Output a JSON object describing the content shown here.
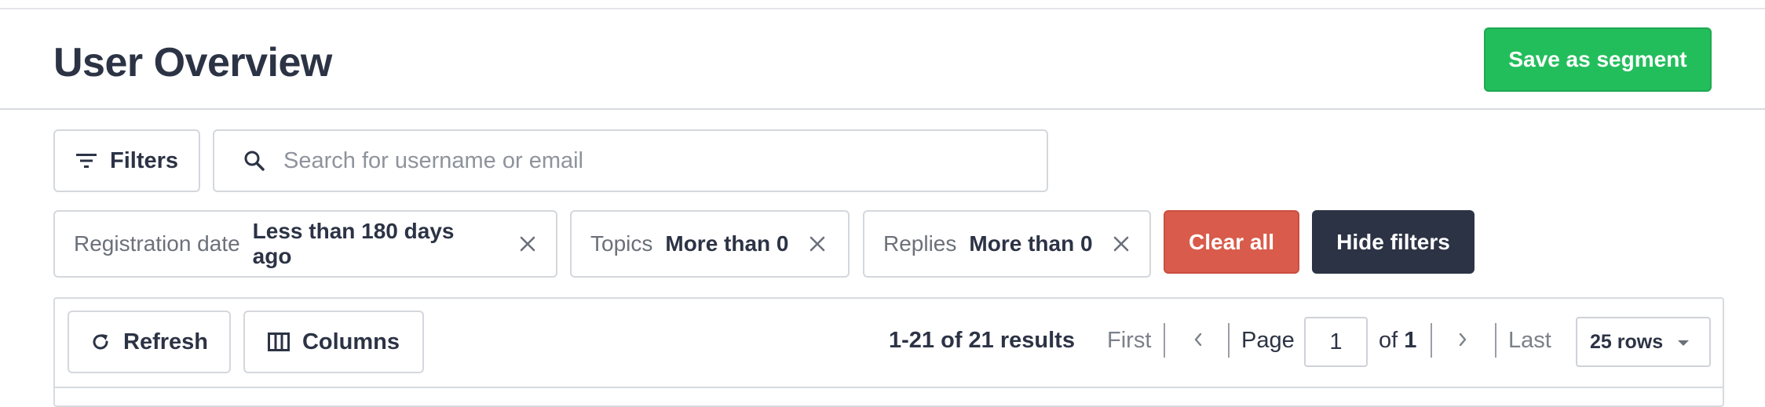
{
  "header": {
    "title": "User Overview",
    "save_segment_label": "Save as segment"
  },
  "filter_bar": {
    "filters_label": "Filters",
    "search_placeholder": "Search for username or email",
    "search_value": ""
  },
  "active_filters": [
    {
      "label": "Registration date",
      "value": "Less than 180 days ago"
    },
    {
      "label": "Topics",
      "value": "More than 0"
    },
    {
      "label": "Replies",
      "value": "More than 0"
    }
  ],
  "filter_actions": {
    "clear_all_label": "Clear all",
    "hide_filters_label": "Hide filters"
  },
  "table_toolbar": {
    "refresh_label": "Refresh",
    "columns_label": "Columns",
    "results_text": "1-21 of 21 results",
    "first_label": "First",
    "last_label": "Last",
    "page_label": "Page",
    "current_page": "1",
    "of_label": "of",
    "total_pages": "1",
    "rows_per_page": "25 rows"
  },
  "colors": {
    "save_button": "#23be5c",
    "clear_button": "#d95b4b",
    "hide_button": "#2c3345",
    "text_primary": "#2c3345"
  },
  "icons": [
    "filter-icon",
    "search-icon",
    "close-icon",
    "refresh-icon",
    "columns-icon",
    "chevron-left-icon",
    "chevron-right-icon",
    "caret-down-icon"
  ]
}
